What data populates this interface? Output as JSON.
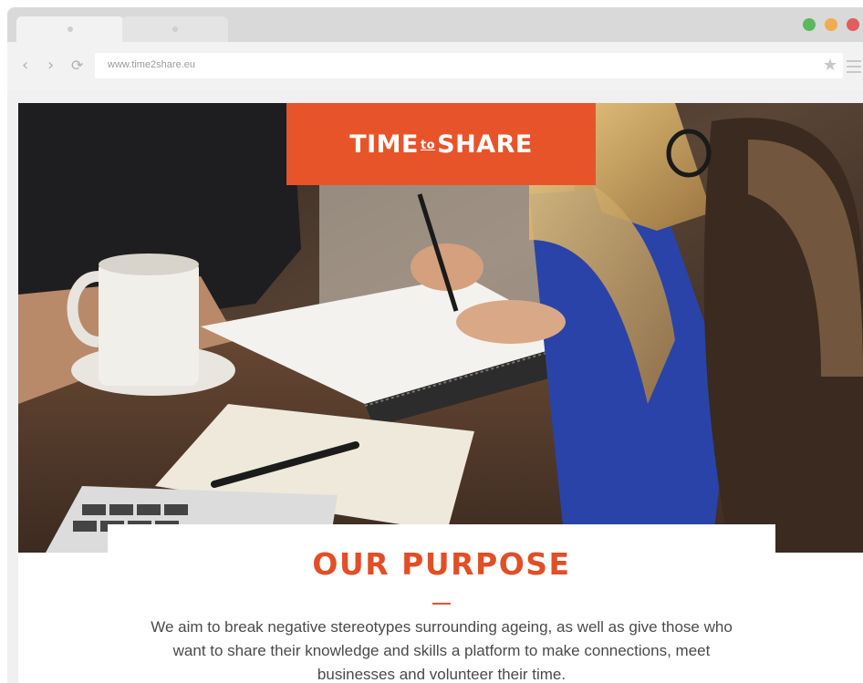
{
  "browser": {
    "url": "www.time2share.eu",
    "traffic_lights": {
      "green": "#5cb85c",
      "yellow": "#f0ad4e",
      "red": "#e25d5d"
    }
  },
  "logo": {
    "part1": "TIME",
    "part2": "to",
    "part3": "SHARE",
    "background": "#e8542a"
  },
  "purpose": {
    "title": "OUR PURPOSE",
    "text": "We aim to break negative stereotypes surrounding ageing, as well as give those who want to share their knowledge and skills a platform to make connections, meet businesses and volunteer their time.",
    "accent": "#e04f26"
  },
  "icons": {
    "back": "chevron-left-icon",
    "forward": "chevron-right-icon",
    "reload": "reload-icon",
    "bookmark": "star-icon",
    "menu": "hamburger-menu-icon"
  }
}
